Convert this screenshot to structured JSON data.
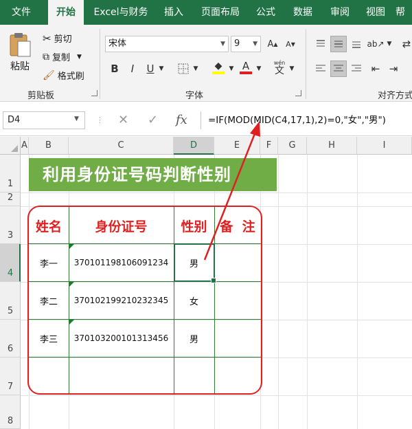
{
  "tabs": [
    "文件",
    "开始",
    "Excel与财务",
    "插入",
    "页面布局",
    "公式",
    "数据",
    "审阅",
    "视图",
    "帮"
  ],
  "clipboard": {
    "paste_label": "粘贴",
    "cut_label": "剪切",
    "copy_label": "复制",
    "format_painter_label": "格式刷",
    "group_label": "剪贴板"
  },
  "font": {
    "name": "宋体",
    "size": "9",
    "bold_label": "B",
    "italic_label": "I",
    "underline_label": "U",
    "phonetic_label": "wén",
    "phonetic_char": "文",
    "group_label": "字体"
  },
  "alignment": {
    "group_label": "对齐方式"
  },
  "formula_bar": {
    "name_box": "D4",
    "cancel_symbol": "✕",
    "enter_symbol": "✓",
    "fx_symbol": "fx",
    "formula": "=IF(MOD(MID(C4,17,1),2)=0,\"女\",\"男\")"
  },
  "columns": [
    "A",
    "B",
    "C",
    "D",
    "E",
    "F",
    "G",
    "H",
    "I"
  ],
  "rows": [
    "1",
    "2",
    "3",
    "4",
    "5",
    "6",
    "7",
    "8"
  ],
  "sheet": {
    "title": "利用身份证号码判断性别",
    "headers": [
      "姓名",
      "身份证号",
      "性别",
      "备  注"
    ],
    "records": [
      {
        "name": "李一",
        "id": "370101198106091234",
        "gender": "男",
        "note": ""
      },
      {
        "name": "李二",
        "id": "370102199210232345",
        "gender": "女",
        "note": ""
      },
      {
        "name": "李三",
        "id": "370103200101313456",
        "gender": "男",
        "note": ""
      }
    ]
  },
  "colors": {
    "excel_green": "#217346",
    "banner_green": "#70ad47",
    "table_red": "#e02020",
    "font_color_bar": "#e02020",
    "highlight_bar": "#ffff00"
  }
}
